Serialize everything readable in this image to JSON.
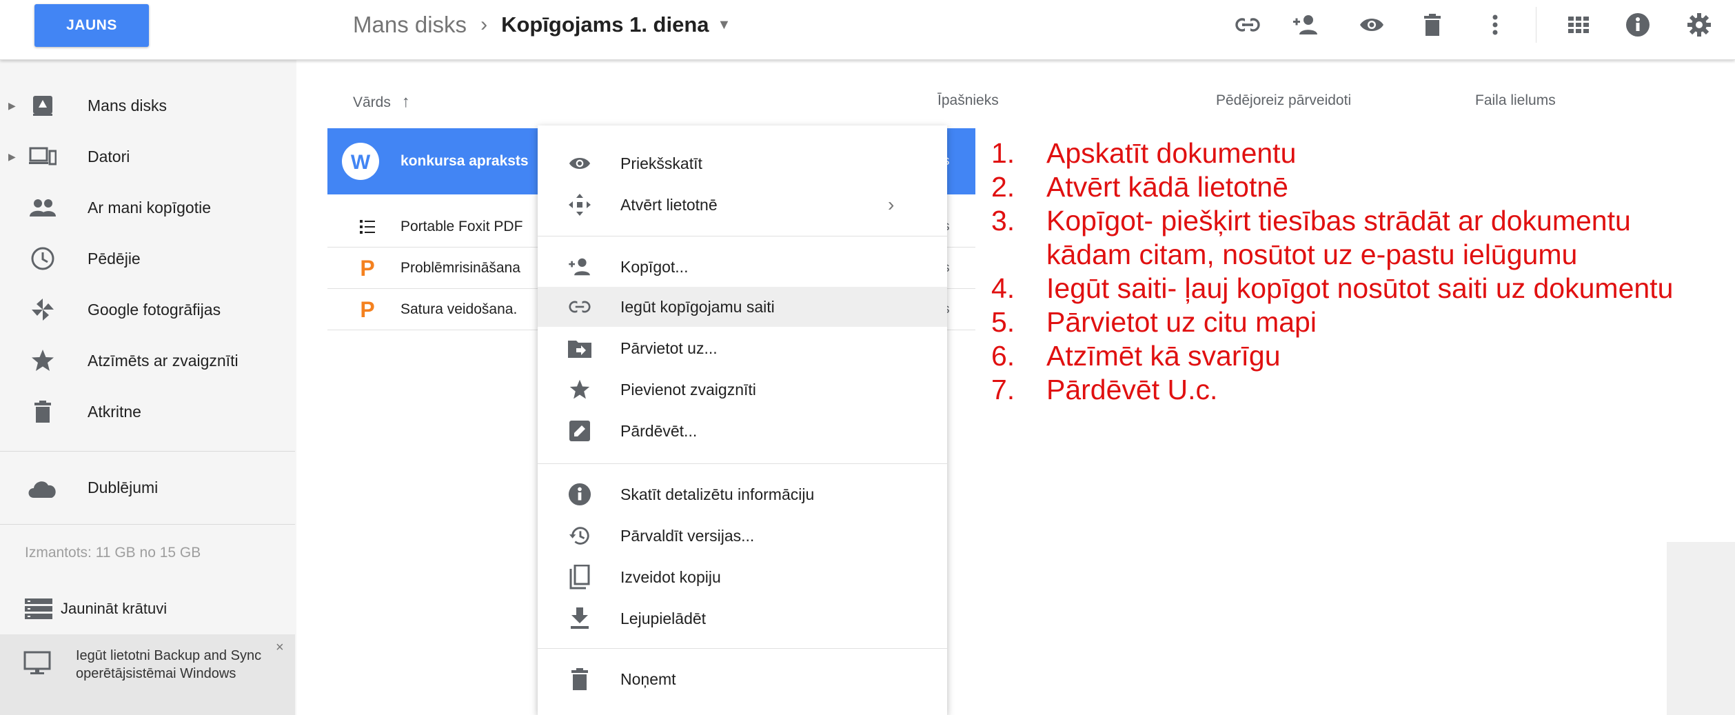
{
  "header": {
    "new_button": "JAUNS",
    "breadcrumb_root": "Mans disks",
    "breadcrumb_sep": "›",
    "breadcrumb_current": "Kopīgojams 1. diena",
    "icons": [
      "link-icon",
      "add-person-icon",
      "eye-icon",
      "trash-icon",
      "more-vert-icon",
      "grid-view-icon",
      "info-icon",
      "settings-icon"
    ]
  },
  "sidebar": {
    "items": [
      {
        "label": "Mans disks",
        "icon": "drive-icon",
        "expandable": true
      },
      {
        "label": "Datori",
        "icon": "computers-icon",
        "expandable": true
      },
      {
        "label": "Ar mani kopīgotie",
        "icon": "people-icon",
        "expandable": false
      },
      {
        "label": "Pēdējie",
        "icon": "clock-icon",
        "expandable": false
      },
      {
        "label": "Google fotogrāfijas",
        "icon": "pinwheel-icon",
        "expandable": false
      },
      {
        "label": "Atzīmēts ar zvaigznīti",
        "icon": "star-icon",
        "expandable": false
      },
      {
        "label": "Atkritne",
        "icon": "trash-icon",
        "expandable": false
      }
    ],
    "backups_label": "Dublējumi",
    "storage_text": "Izmantots: 11 GB no 15 GB",
    "upgrade_label": "Jaunināt krātuvi",
    "backup_promo": "Iegūt lietotni Backup and Sync operētājsistēmai Windows",
    "close_glyph": "×"
  },
  "list": {
    "columns": {
      "name": "Vārds",
      "sort_glyph": "↑",
      "owner": "Īpašnieks",
      "modified": "Pēdējoreiz pārveidoti",
      "size": "Faila lielums"
    },
    "rows": [
      {
        "name": "konkursa apraksts",
        "type": "word",
        "owner_fragment": "s",
        "selected": true
      },
      {
        "name": "Portable Foxit PDF",
        "type": "list",
        "owner_fragment": "s",
        "selected": false
      },
      {
        "name": "Problēmrisināšana",
        "type": "pres",
        "owner_fragment": "s",
        "selected": false
      },
      {
        "name": "Satura veidošana.",
        "type": "pres",
        "owner_fragment": "s",
        "selected": false
      }
    ]
  },
  "context_menu": {
    "items": [
      {
        "label": "Priekšskatīt",
        "icon": "eye-icon"
      },
      {
        "label": "Atvērt lietotnē",
        "icon": "move-arrows-icon",
        "submenu": "›"
      },
      {
        "label": "Kopīgot...",
        "icon": "add-person-icon"
      },
      {
        "label": "Iegūt kopīgojamu saiti",
        "icon": "link-icon",
        "highlighted": true
      },
      {
        "label": "Pārvietot uz...",
        "icon": "move-to-folder-icon"
      },
      {
        "label": "Pievienot zvaigznīti",
        "icon": "star-icon"
      },
      {
        "label": "Pārdēvēt...",
        "icon": "rename-icon"
      },
      {
        "label": "Skatīt detalizētu informāciju",
        "icon": "info-icon"
      },
      {
        "label": "Pārvaldīt versijas...",
        "icon": "history-icon"
      },
      {
        "label": "Izveidot kopiju",
        "icon": "copy-icon"
      },
      {
        "label": "Lejupielādēt",
        "icon": "download-icon"
      },
      {
        "label": "Noņemt",
        "icon": "trash-icon"
      }
    ]
  },
  "annotation": {
    "color": "#e01010",
    "items": [
      {
        "num": "1.",
        "text": "Apskatīt dokumentu"
      },
      {
        "num": "2.",
        "text": "Atvērt kādā lietotnē"
      },
      {
        "num": "3.",
        "text": "Kopīgot- piešķirt tiesības strādāt ar dokumentu kādam citam, nosūtot uz e-pastu ielūgumu"
      },
      {
        "num": "4.",
        "text": "Iegūt saiti- ļauj kopīgot nosūtot saiti uz dokumentu"
      },
      {
        "num": "5.",
        "text": "Pārvietot uz citu mapi"
      },
      {
        "num": "6.",
        "text": "Atzīmēt kā svarīgu"
      },
      {
        "num": "7.",
        "text": "Pārdēvēt U.c."
      }
    ]
  },
  "colors": {
    "accent": "#4285f4",
    "word_icon": "#4285f4",
    "pres_icon": "#f4811f",
    "annotation": "#e01010"
  }
}
